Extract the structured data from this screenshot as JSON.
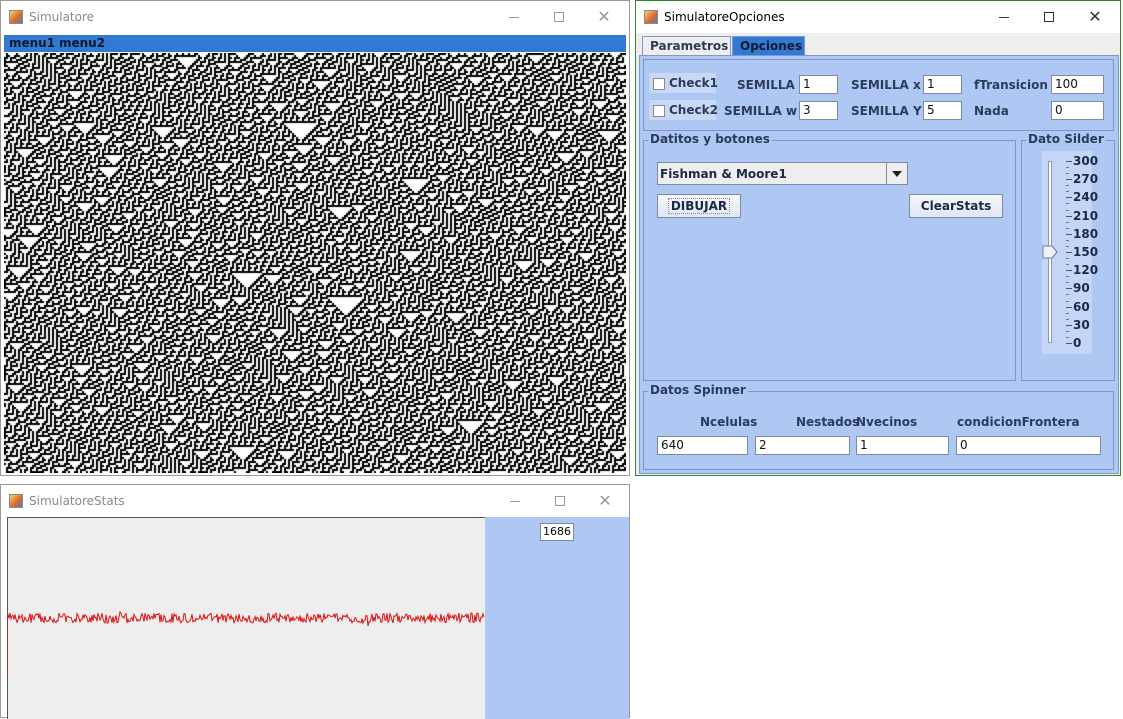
{
  "simulatore": {
    "title": "Simulatore",
    "menus": [
      "menu1",
      "menu2"
    ]
  },
  "opciones": {
    "title": "SimulatoreOpciones",
    "tabs": [
      "Parametros",
      "Opciones"
    ],
    "params": {
      "check1": "Check1",
      "check2": "Check2",
      "semilla_label": "SEMILLA",
      "semilla_value": "1",
      "semilla_x_label": "SEMILLA x",
      "semilla_x_value": "1",
      "ftransicion_label": "fTransicion",
      "ftransicion_value": "100",
      "semilla_w_label": "SEMILLA w",
      "semilla_w_value": "3",
      "semilla_y_label": "SEMILLA Y",
      "semilla_y_value": "5",
      "nada_label": "Nada",
      "nada_value": "0"
    },
    "datitos": {
      "title": "Datitos y botones",
      "combo_value": "Fishman & Moore1",
      "dibujar": "DIBUJAR",
      "clearstats": "ClearStats"
    },
    "slider": {
      "title": "Dato Silder",
      "ticks": [
        "300",
        "270",
        "240",
        "210",
        "180",
        "150",
        "120",
        "90",
        "60",
        "30",
        "0"
      ],
      "value": 150,
      "min": 0,
      "max": 300
    },
    "spinner": {
      "title": "Datos Spinner",
      "ncelulas_label": "Ncelulas",
      "ncelulas_value": "640",
      "nestados_label": "Nestados",
      "nestados_value": "2",
      "nvecinos_label": "Nvecinos",
      "nvecinos_value": "1",
      "condicion_label": "condicionFrontera",
      "condicion_value": "0"
    }
  },
  "stats": {
    "title": "SimulatoreStats",
    "counter": "1686"
  },
  "colors": {
    "accent": "#3179d3",
    "panel": "#aec7f3",
    "plot_line": "#e01010",
    "active_border": "#2d8a33"
  }
}
